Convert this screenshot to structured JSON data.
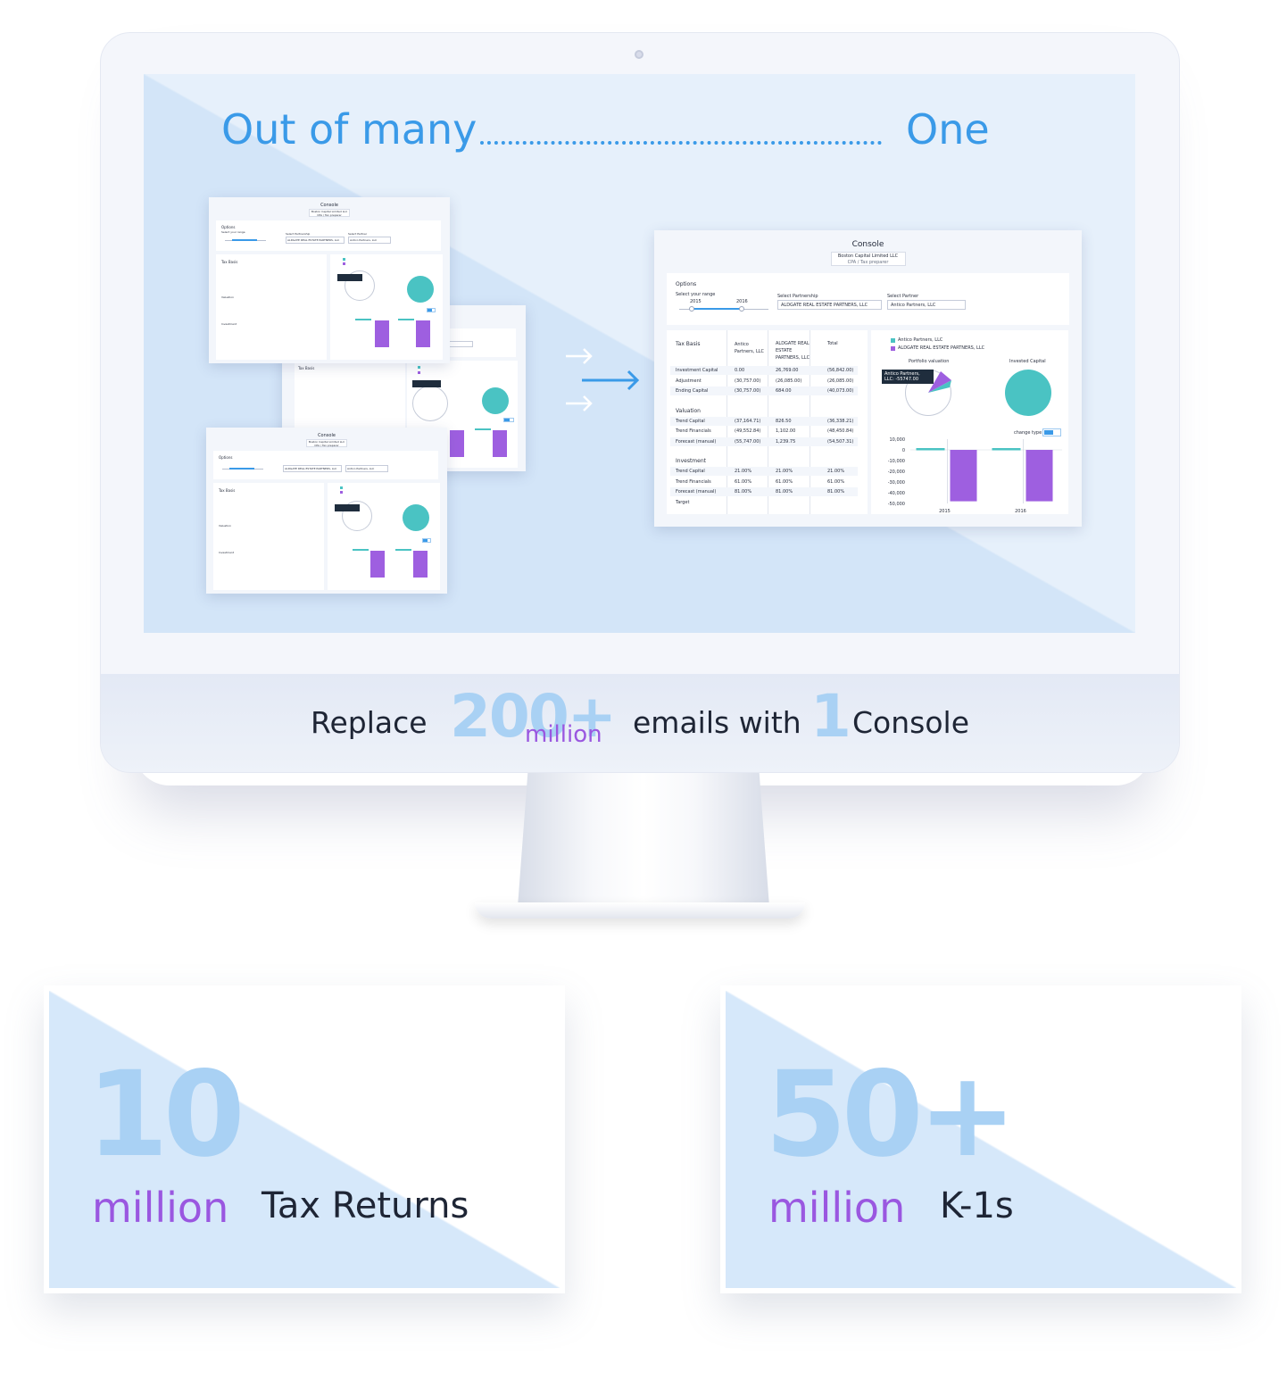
{
  "headline": {
    "left": "Out of many",
    "right": "One"
  },
  "console": {
    "title": "Console",
    "account": "Boston Capital Limited LLC",
    "role": "CPA / Tax preparer",
    "options_label": "Options",
    "range_label": "Select your range",
    "range_start": "2015",
    "range_end": "2016",
    "partnership_label": "Select Partnership",
    "partnership_value": "ALDGATE REAL ESTATE PARTNERS, LLC",
    "partner_label": "Select Partner",
    "partner_value": "Antico Partners, LLC",
    "table": {
      "header": [
        "Tax Basis",
        "Antico Partners, LLC",
        "ALDGATE REAL ESTATE PARTNERS, LLC",
        "Total"
      ],
      "sections": [
        {
          "title": "",
          "rows": [
            [
              "Investment Capital",
              "0.00",
              "26,769.00",
              "(56,842.00)"
            ],
            [
              "Adjustment",
              "(30,757.00)",
              "(26,085.00)",
              "(26,085.00)"
            ],
            [
              "Ending Capital",
              "(30,757.00)",
              "684.00",
              "(40,073.00)"
            ]
          ]
        },
        {
          "title": "Valuation",
          "rows": [
            [
              "Trend Capital",
              "(37,164.71)",
              "826.50",
              "(36,338.21)"
            ],
            [
              "Trend Financials",
              "(49,552.84)",
              "1,102.00",
              "(48,450.84)"
            ],
            [
              "Forecast (manual)",
              "(55,747.00)",
              "1,239.75",
              "(54,507.31)"
            ]
          ]
        },
        {
          "title": "Investment",
          "rows": [
            [
              "Trend Capital",
              "21.00%",
              "21.00%",
              "21.00%"
            ],
            [
              "Trend Financials",
              "61.00%",
              "61.00%",
              "61.00%"
            ],
            [
              "Forecast (manual)",
              "81.00%",
              "81.00%",
              "81.00%"
            ],
            [
              "Target",
              "",
              "",
              ""
            ]
          ]
        }
      ]
    },
    "legend": [
      "Antico Partners, LLC",
      "ALDGATE REAL ESTATE PARTNERS, LLC"
    ],
    "portfolio_label": "Portfolio valuation",
    "invested_label": "Invested Capital",
    "tooltip": "Antico Partners, LLC: -55747.00",
    "change_type_label": "change type",
    "y_ticks": [
      "10,000",
      "0",
      "-10,000",
      "-20,000",
      "-30,000",
      "-40,000",
      "-50,000"
    ],
    "x_ticks": [
      "2015",
      "2016"
    ]
  },
  "chart_data": {
    "type": "bar",
    "categories": [
      "2015",
      "2016"
    ],
    "series": [
      {
        "name": "",
        "values": [
          -48000,
          -48000
        ]
      }
    ],
    "ylim": [
      -50000,
      10000
    ]
  },
  "replace": {
    "prefix": "Replace",
    "number": "200+",
    "unit": "million",
    "middle": "emails with",
    "one": "1",
    "suffix": "Console"
  },
  "stats": [
    {
      "number": "10",
      "unit": "million",
      "label": "Tax Returns"
    },
    {
      "number": "50+",
      "unit": "million",
      "label": "K-1s"
    }
  ],
  "colors": {
    "accent": "#3a9ae8",
    "light_blue": "#a9d1f4",
    "purple": "#9a57e0",
    "teal": "#4ac3c3",
    "bar": "#9e5fe0"
  }
}
